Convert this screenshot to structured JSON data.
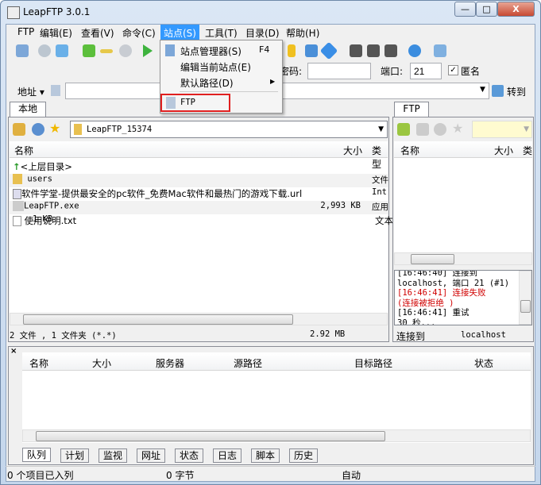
{
  "window": {
    "title": "LeapFTP 3.0.1",
    "min": "—",
    "max": "□",
    "close": "X"
  },
  "menu": [
    "FTP",
    "编辑(E)",
    "查看(V)",
    "命令(C)",
    "站点(S)",
    "工具(T)",
    "目录(D)",
    "帮助(H)"
  ],
  "dropdown": {
    "items": [
      {
        "label": "站点管理器(S)",
        "shortcut": "F4"
      },
      {
        "label": "编辑当前站点(E)"
      },
      {
        "label": "默认路径(D)",
        "arrow": "▶"
      },
      {
        "label": "FTP"
      }
    ]
  },
  "login": {
    "password_label": "密码:",
    "password": "",
    "port_label": "端口:",
    "port": "21",
    "anon_label": "匿名",
    "anon_check": "✓"
  },
  "address": {
    "label": "地址 ▾",
    "value": "",
    "go_label": "转到"
  },
  "local": {
    "tab": "本地",
    "path": "LeapFTP_15374",
    "cols": [
      "名称",
      "大小",
      "类型"
    ],
    "rows": [
      {
        "name": "<上层目录>",
        "size": "",
        "type": ""
      },
      {
        "name": "users",
        "size": "",
        "type": "文件"
      },
      {
        "name": "软件学堂-提供最安全的pc软件_免费Mac软件和最热门的游戏下载.url",
        "size": "",
        "type": "Int"
      },
      {
        "name": "LeapFTP.exe",
        "size": "2,993 KB",
        "type": "应用"
      },
      {
        "name": "使用说明.txt",
        "size": "1 KB",
        "type": "文本"
      }
    ],
    "status": "2 文件 , 1 文件夹 (*.*)",
    "total": "2.92 MB"
  },
  "remote": {
    "tab": "FTP",
    "cols": [
      "名称",
      "大小",
      "类"
    ],
    "log": [
      {
        "t": "[16:46:40] 连接到",
        "c": "#000"
      },
      {
        "t": "localhost, 端口 21 (#1)",
        "c": "#000"
      },
      {
        "t": "[16:46:41] 连接失败",
        "c": "#d00000"
      },
      {
        "t": "(连接被拒绝          )",
        "c": "#d00000"
      },
      {
        "t": "[16:46:41] 重试",
        "c": "#000"
      },
      {
        "t": "30 秒...",
        "c": "#000"
      }
    ],
    "status": "连接到",
    "host": "localhost"
  },
  "queue": {
    "cols": [
      "名称",
      "大小",
      "服务器",
      "源路径",
      "目标路径",
      "状态"
    ],
    "tabs": [
      "队列",
      "计划",
      "监视",
      "网址",
      "状态",
      "日志",
      "脚本",
      "历史"
    ]
  },
  "statusbar": {
    "items": "0 个项目已入列",
    "bytes": "0 字节",
    "mode": "自动"
  },
  "colors": {
    "accent": "#3399ff",
    "highlight_box": "#e02020",
    "error": "#d00000"
  }
}
